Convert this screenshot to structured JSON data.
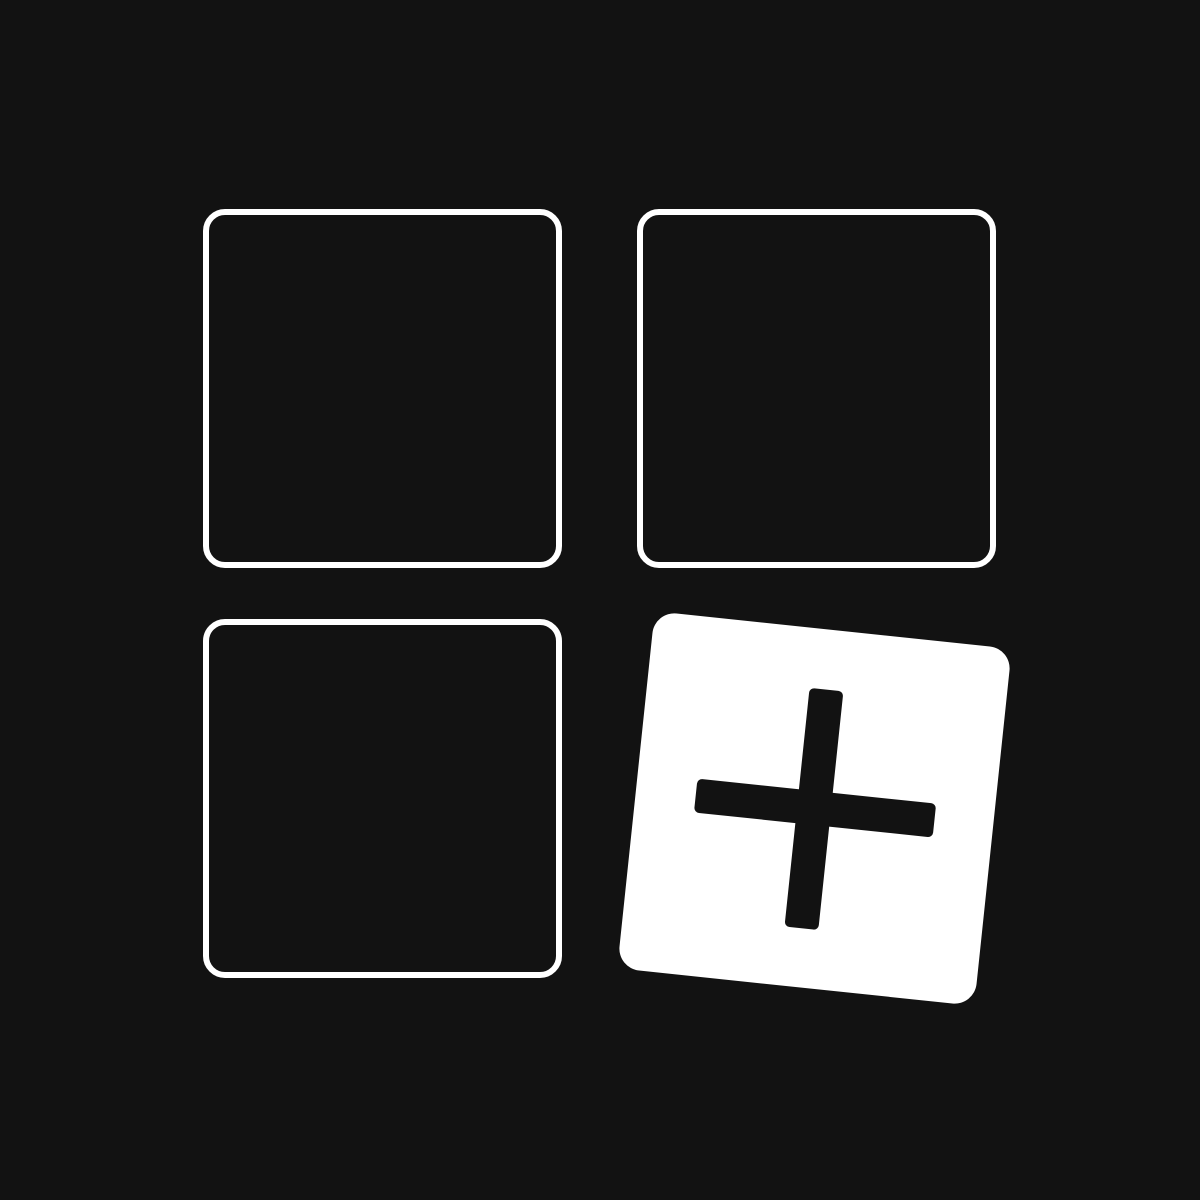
{
  "icon": {
    "name": "add-tile-icon",
    "background_color": "#121212",
    "foreground_color": "#ffffff",
    "tiles": [
      {
        "name": "tile-outline",
        "style": "outlined"
      },
      {
        "name": "tile-outline",
        "style": "outlined"
      },
      {
        "name": "tile-outline",
        "style": "outlined"
      },
      {
        "name": "add-tile",
        "style": "filled-tilted",
        "glyph": "plus-icon"
      }
    ]
  }
}
